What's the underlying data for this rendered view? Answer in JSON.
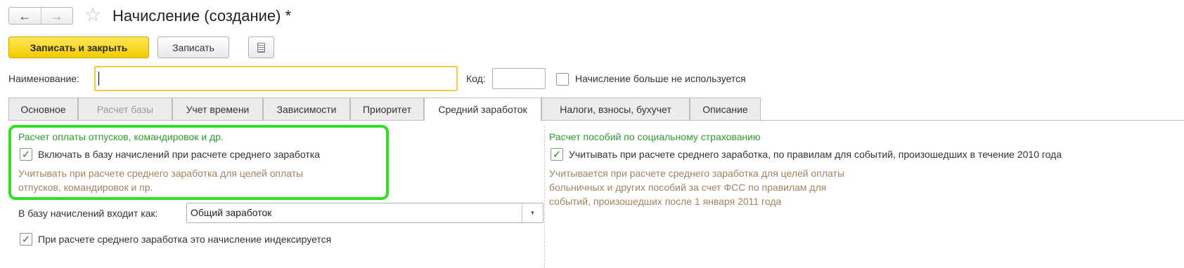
{
  "window": {
    "back_icon": "←",
    "forward_icon": "→",
    "star_icon": "☆",
    "title": "Начисление (создание) *"
  },
  "toolbar": {
    "save_close_label": "Записать и закрыть",
    "save_label": "Записать",
    "more_icon": "document-list-icon"
  },
  "fields": {
    "name_label": "Наименование:",
    "name_value": "",
    "code_label": "Код:",
    "code_value": "",
    "unused_label": "Начисление больше не используется",
    "unused_checked": false
  },
  "tabs": [
    {
      "label": "Основное",
      "state": "normal"
    },
    {
      "label": "Расчет базы",
      "state": "disabled"
    },
    {
      "label": "Учет времени",
      "state": "normal"
    },
    {
      "label": "Зависимости",
      "state": "normal"
    },
    {
      "label": "Приоритет",
      "state": "normal"
    },
    {
      "label": "Средний заработок",
      "state": "active"
    },
    {
      "label": "Налоги, взносы, бухучет",
      "state": "normal"
    },
    {
      "label": "Описание",
      "state": "normal"
    }
  ],
  "left": {
    "group_title": "Расчет оплаты отпусков, командировок и др.",
    "include_label": "Включать в базу начислений при расчете среднего заработка",
    "include_checked": true,
    "hint_line1": "Учитывать при расчете среднего заработка для целей оплаты",
    "hint_line2": "отпусков, командировок и пр.",
    "base_label": "В базу начислений входит как:",
    "base_value": "Общий заработок",
    "dropdown_icon": "▼",
    "indexed_label": "При расчете среднего заработка это начисление индексируется",
    "indexed_checked": true
  },
  "right": {
    "group_title": "Расчет пособий по социальному страхованию",
    "consider_label": "Учитывать при расчете среднего заработка, по правилам для событий, произошедших в течение 2010 года",
    "consider_checked": true,
    "hint_line1": "Учитывается при расчете среднего заработка для целей оплаты",
    "hint_line2": "больничных и других пособий за счет ФСС по правилам для",
    "hint_line3": "событий, произошедших после 1 января 2011 года"
  },
  "check_mark": "✓",
  "colors": {
    "primary_button": "#f5cc00",
    "focus_border": "#f3c94a",
    "group_title": "#2f9a2f",
    "hint_text": "#a3825f",
    "highlight": "#33dd22"
  }
}
